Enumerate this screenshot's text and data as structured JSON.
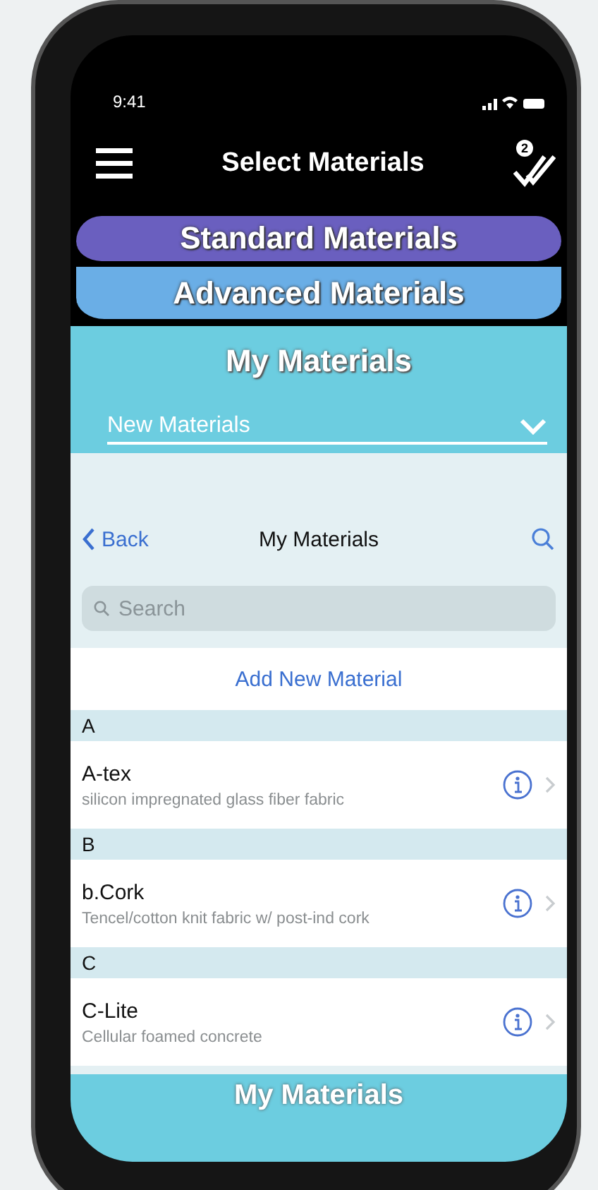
{
  "status_bar": {
    "time": "9:41"
  },
  "header": {
    "title": "Select Materials",
    "badge": "2"
  },
  "tabs": [
    {
      "label": "Standard Materials",
      "selected": false
    },
    {
      "label": "Advanced Materials",
      "selected": false
    },
    {
      "label": "My Materials",
      "selected": true
    }
  ],
  "dropdown": {
    "value": "New Materials"
  },
  "sheet": {
    "back": "Back",
    "title": "My Materials",
    "search": {
      "placeholder": "Search"
    },
    "add_button": "Add New Material",
    "sections": [
      {
        "letter": "A",
        "items": [
          {
            "name": "A-tex",
            "description": "silicon impregnated glass fiber fabric"
          }
        ]
      },
      {
        "letter": "B",
        "items": [
          {
            "name": "b.Cork",
            "description": "Tencel/cotton knit fabric w/ post-ind cork"
          }
        ]
      },
      {
        "letter": "C",
        "items": [
          {
            "name": "C-Lite",
            "description": "Cellular foamed concrete"
          }
        ]
      }
    ]
  },
  "footer_tab": "My Materials"
}
